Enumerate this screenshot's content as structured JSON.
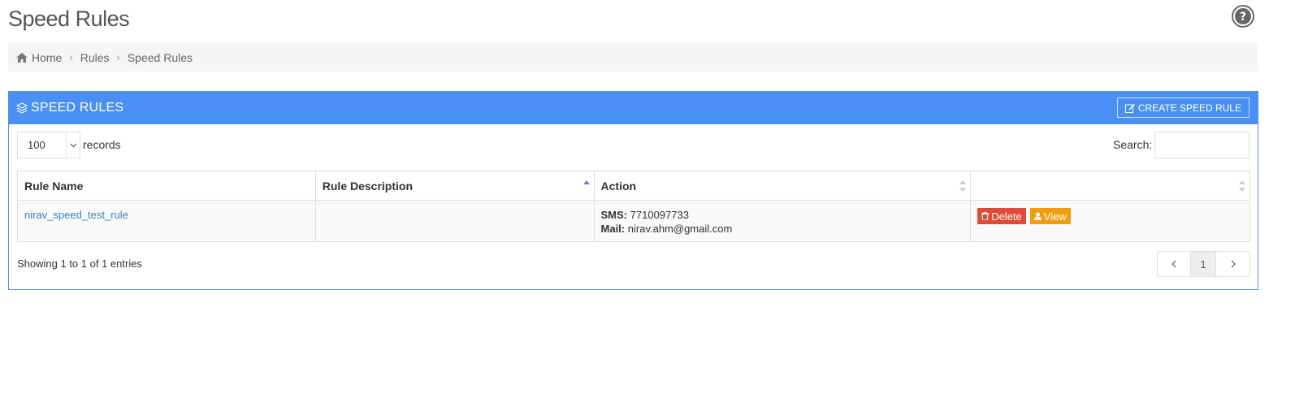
{
  "page": {
    "title": "Speed Rules"
  },
  "icons": {
    "help": "help-circle-icon",
    "home": "home-icon",
    "layers": "layers-icon",
    "edit": "edit-icon",
    "trash": "trash-icon",
    "user": "user-icon"
  },
  "breadcrumb": {
    "items": [
      "Home",
      "Rules",
      "Speed Rules"
    ]
  },
  "panel": {
    "title": "SPEED RULES",
    "create_label": "CREATE SPEED RULE"
  },
  "controls": {
    "page_length": "100",
    "records_label": "records",
    "search_label": "Search:",
    "search_value": ""
  },
  "table": {
    "headers": [
      "Rule Name",
      "Rule Description",
      "Action",
      ""
    ],
    "rows": [
      {
        "rule_name": "nirav_speed_test_rule",
        "rule_description": "",
        "sms_label": "SMS:",
        "sms_value": "7710097733",
        "mail_label": "Mail:",
        "mail_value": "nirav.ahm@gmail.com",
        "delete_label": "Delete",
        "view_label": "View"
      }
    ]
  },
  "footer": {
    "info": "Showing 1 to 1 of 1 entries",
    "current_page": "1"
  },
  "colors": {
    "header_blue": "#4a8ff3",
    "delete_red": "#dd4b39",
    "view_orange": "#f39c12",
    "link_blue": "#3a7fc1"
  }
}
